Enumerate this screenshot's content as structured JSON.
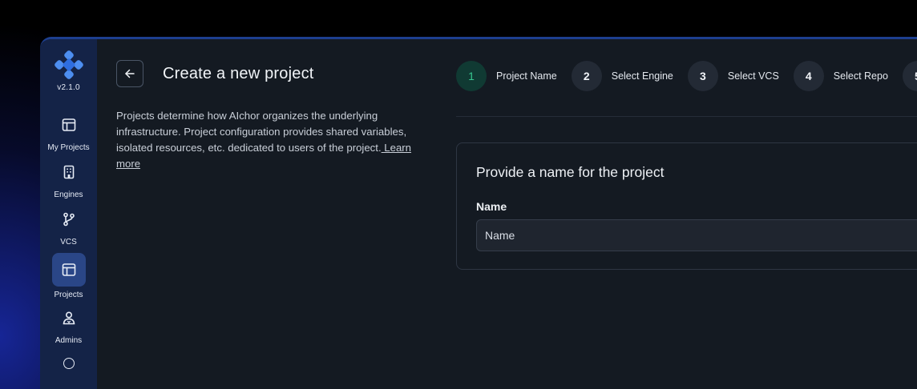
{
  "app": {
    "version": "v2.1.0"
  },
  "sidebar": {
    "items": [
      {
        "label": "My Projects",
        "icon": "layout-icon",
        "active": false
      },
      {
        "label": "Engines",
        "icon": "building-icon",
        "active": false
      },
      {
        "label": "VCS",
        "icon": "git-branch-icon",
        "active": false
      },
      {
        "label": "Projects",
        "icon": "layout-icon",
        "active": true
      },
      {
        "label": "Admins",
        "icon": "user-admin-icon",
        "active": false
      }
    ]
  },
  "header": {
    "title": "Create a new project",
    "back_icon": "arrow-left-icon"
  },
  "description": {
    "text": "Projects determine how AIchor organizes the underlying infrastructure.  Project configuration provides shared variables, isolated resources,  etc. dedicated to users of the project.",
    "link": " Learn more"
  },
  "steps": [
    {
      "number": "1",
      "label": "Project Name",
      "active": true
    },
    {
      "number": "2",
      "label": "Select Engine",
      "active": false
    },
    {
      "number": "3",
      "label": "Select VCS",
      "active": false
    },
    {
      "number": "4",
      "label": "Select Repo",
      "active": false
    },
    {
      "number": "5",
      "label": "",
      "active": false
    }
  ],
  "form": {
    "title": "Provide a name for the project",
    "name_label": "Name",
    "name_placeholder": "Name"
  },
  "colors": {
    "sidebar": "#142347",
    "background": "#141a22",
    "active_step": "#37c58f",
    "accent": "#2a4687"
  }
}
